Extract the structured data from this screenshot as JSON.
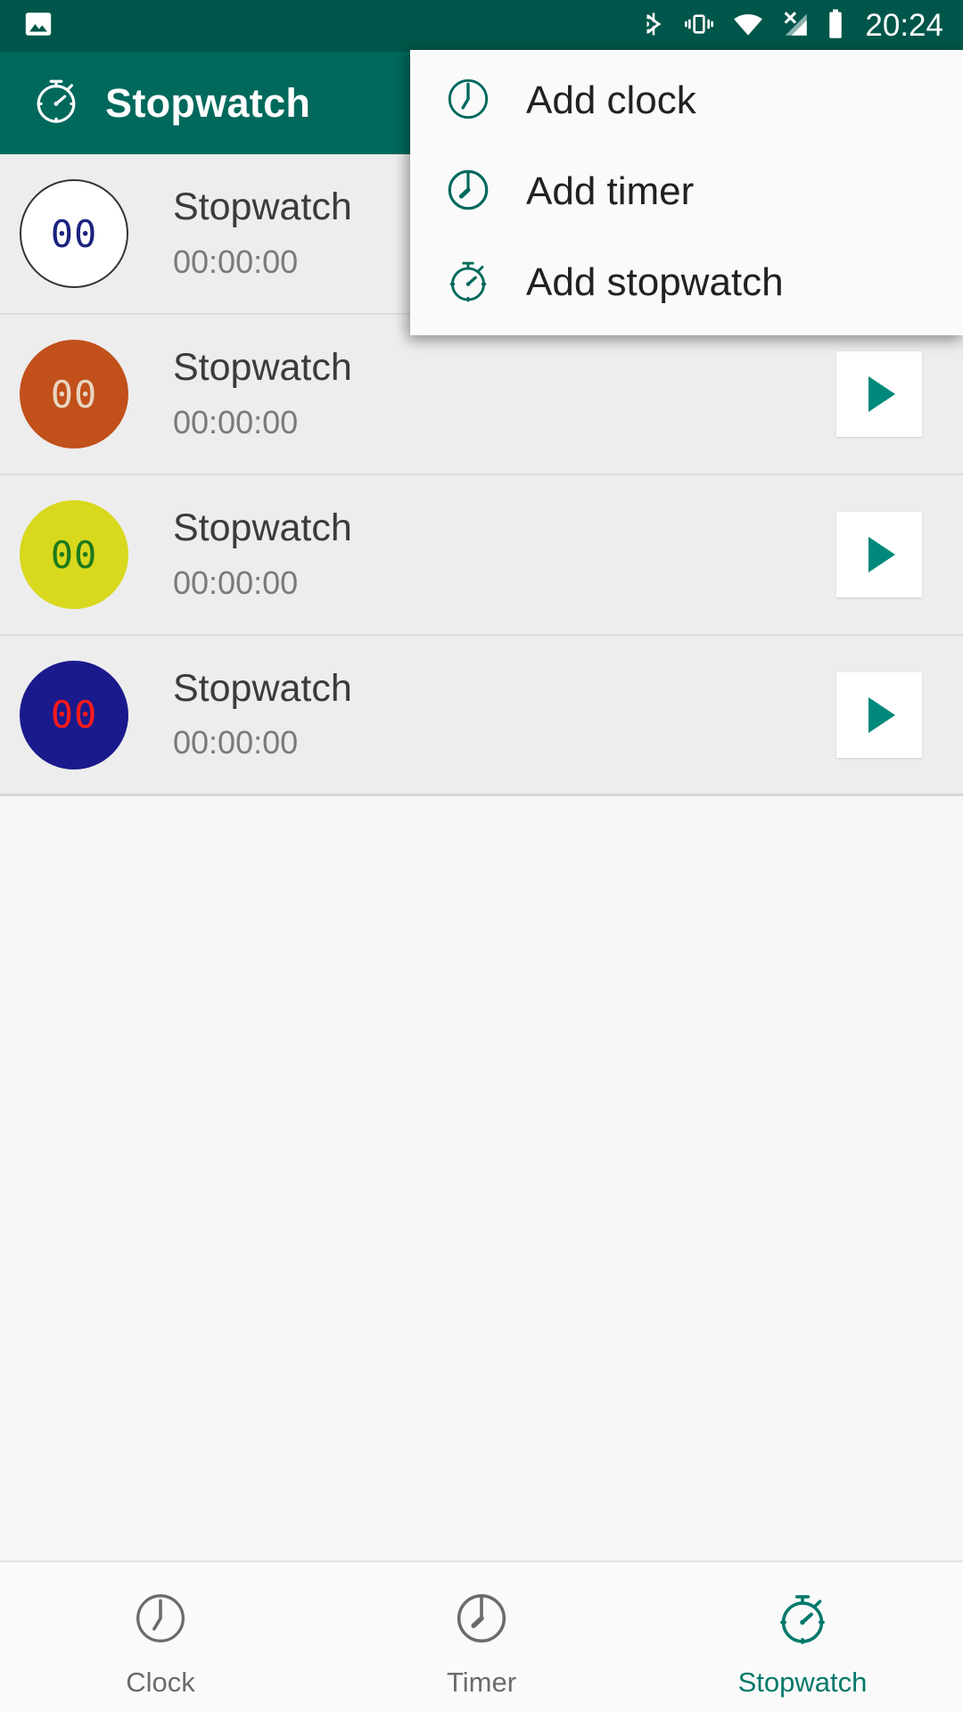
{
  "status_bar": {
    "time": "20:24",
    "icons": [
      "image-notification-icon",
      "bluetooth-icon",
      "vibrate-icon",
      "wifi-icon",
      "cellular-signal-off-icon",
      "battery-icon"
    ],
    "background_color": "#00564a"
  },
  "toolbar": {
    "title": "Stopwatch",
    "icon": "stopwatch-icon",
    "background_color": "#00695c",
    "text_color": "#ffffff"
  },
  "menu": {
    "items": [
      {
        "label": "Add clock",
        "icon": "clock-icon"
      },
      {
        "label": "Add timer",
        "icon": "timer-icon"
      },
      {
        "label": "Add stopwatch",
        "icon": "stopwatch-icon"
      }
    ],
    "accent_color": "#00695c",
    "background_color": "#fafafa"
  },
  "list": {
    "rows": [
      {
        "title": "Stopwatch",
        "time": "00:00:00",
        "avatar_text": "00",
        "avatar_bg": "#ffffff",
        "avatar_fg": "#1a237e",
        "avatar_border": "#333333",
        "has_play": false
      },
      {
        "title": "Stopwatch",
        "time": "00:00:00",
        "avatar_text": "00",
        "avatar_bg": "#c1501a",
        "avatar_fg": "#e8d5c0",
        "avatar_border": "transparent",
        "has_play": true
      },
      {
        "title": "Stopwatch",
        "time": "00:00:00",
        "avatar_text": "00",
        "avatar_bg": "#d8d81e",
        "avatar_fg": "#1b7a1b",
        "avatar_border": "transparent",
        "has_play": true
      },
      {
        "title": "Stopwatch",
        "time": "00:00:00",
        "avatar_text": "00",
        "avatar_bg": "#1a1a8c",
        "avatar_fg": "#ff1a1a",
        "avatar_border": "transparent",
        "has_play": true
      }
    ],
    "play_icon": "play-icon",
    "row_background": "#ededee"
  },
  "bottom_nav": {
    "tabs": [
      {
        "label": "Clock",
        "icon": "clock-icon",
        "active": false
      },
      {
        "label": "Timer",
        "icon": "timer-icon",
        "active": false
      },
      {
        "label": "Stopwatch",
        "icon": "stopwatch-icon",
        "active": true
      }
    ],
    "active_color": "#00796b",
    "inactive_color": "#6b6b6b"
  }
}
